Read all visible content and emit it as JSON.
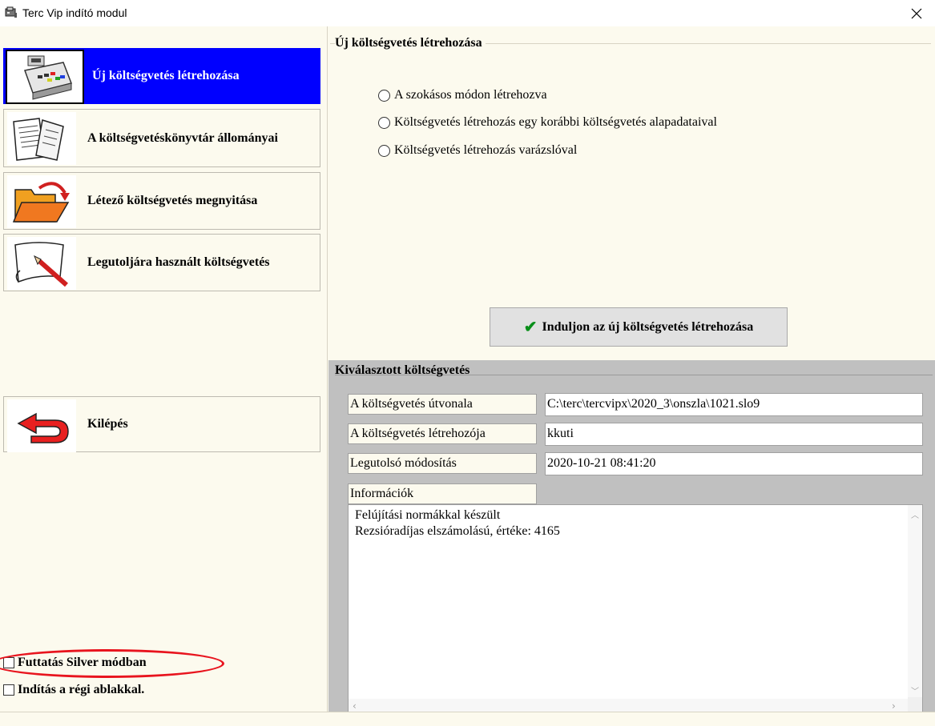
{
  "window": {
    "title": "Terc Vip indító modul"
  },
  "left": {
    "buttons": [
      {
        "label": "Új költségvetés létrehozása",
        "icon": "cash-register-icon",
        "active": true
      },
      {
        "label": "A költségvetéskönyvtár állományai",
        "icon": "documents-icon",
        "active": false
      },
      {
        "label": "Létező költségvetés megnyitása",
        "icon": "open-folder-icon",
        "active": false
      },
      {
        "label": "Legutoljára használt költségvetés",
        "icon": "paper-pencil-icon",
        "active": false
      }
    ],
    "exit": {
      "label": "Kilépés",
      "icon": "back-arrow-icon"
    },
    "checkboxes": [
      {
        "label": "Futtatás Silver módban",
        "checked": false
      },
      {
        "label": "Indítás a régi ablakkal.",
        "checked": false
      }
    ]
  },
  "new_group": {
    "title": "Új költségvetés létrehozása",
    "options": [
      "A szokásos módon létrehozva",
      "Költségvetés létrehozás egy korábbi költségvetés alapadataival",
      "Költségvetés létrehozás varázslóval"
    ],
    "start_button": "Induljon az új költségvetés létrehozása"
  },
  "selected_group": {
    "title": "Kiválasztott költségvetés",
    "fields": [
      {
        "label": "A költségvetés útvonala",
        "value": "C:\\terc\\tercvipx\\2020_3\\onszla\\1021.slo9"
      },
      {
        "label": "A költségvetés létrehozója",
        "value": "kkuti"
      },
      {
        "label": "Legutolsó módosítás",
        "value": "2020-10-21 08:41:20"
      }
    ],
    "info_label": "Információk",
    "info_lines": [
      "Felújítási normákkal készült",
      "Rezsióradíjas elszámolású, értéke: 4165"
    ]
  },
  "colors": {
    "active_button": "#0000ff",
    "panel_background": "#fcfaee",
    "group_background": "#c0c0c0",
    "highlight_ellipse": "#e8141e",
    "check_mark": "#0a8f1a"
  }
}
